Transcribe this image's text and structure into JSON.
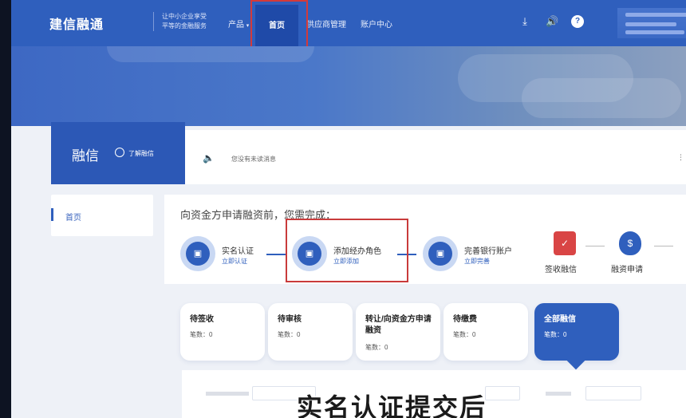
{
  "header": {
    "logo": "建信融通",
    "slogan_line1": "让中小企业享受",
    "slogan_line2": "平等的金融服务",
    "nav": [
      {
        "label": "产品"
      },
      {
        "label": "首页"
      },
      {
        "label": "供应商管理"
      },
      {
        "label": "账户中心"
      }
    ],
    "help_icon_text": "?"
  },
  "panel": {
    "title": "融信",
    "learn_link": "了解融信",
    "notice": "您没有未读消息"
  },
  "sidebar": {
    "items": [
      {
        "label": "首页"
      }
    ]
  },
  "steps": {
    "title": "向资金方申请融资前，您需完成：",
    "items": [
      {
        "name": "实名认证",
        "link": "立即认证"
      },
      {
        "name": "添加经办角色",
        "link": "立即添加"
      },
      {
        "name": "完善银行账户",
        "link": "立即完善"
      }
    ],
    "tail_items": [
      {
        "label": "签收融信"
      },
      {
        "label": "融资申请"
      }
    ]
  },
  "cards": [
    {
      "title": "待签收",
      "count": "笔数：0"
    },
    {
      "title": "待审核",
      "count": "笔数：0"
    },
    {
      "title": "转让/向资金方申请融资",
      "count": "笔数：0"
    },
    {
      "title": "待缴费",
      "count": "笔数：0"
    },
    {
      "title": "全部融信",
      "count": "笔数：0"
    }
  ],
  "caption": "实名认证提交后",
  "colors": {
    "primary": "#2f5fbd",
    "highlight": "#d33a3a"
  }
}
